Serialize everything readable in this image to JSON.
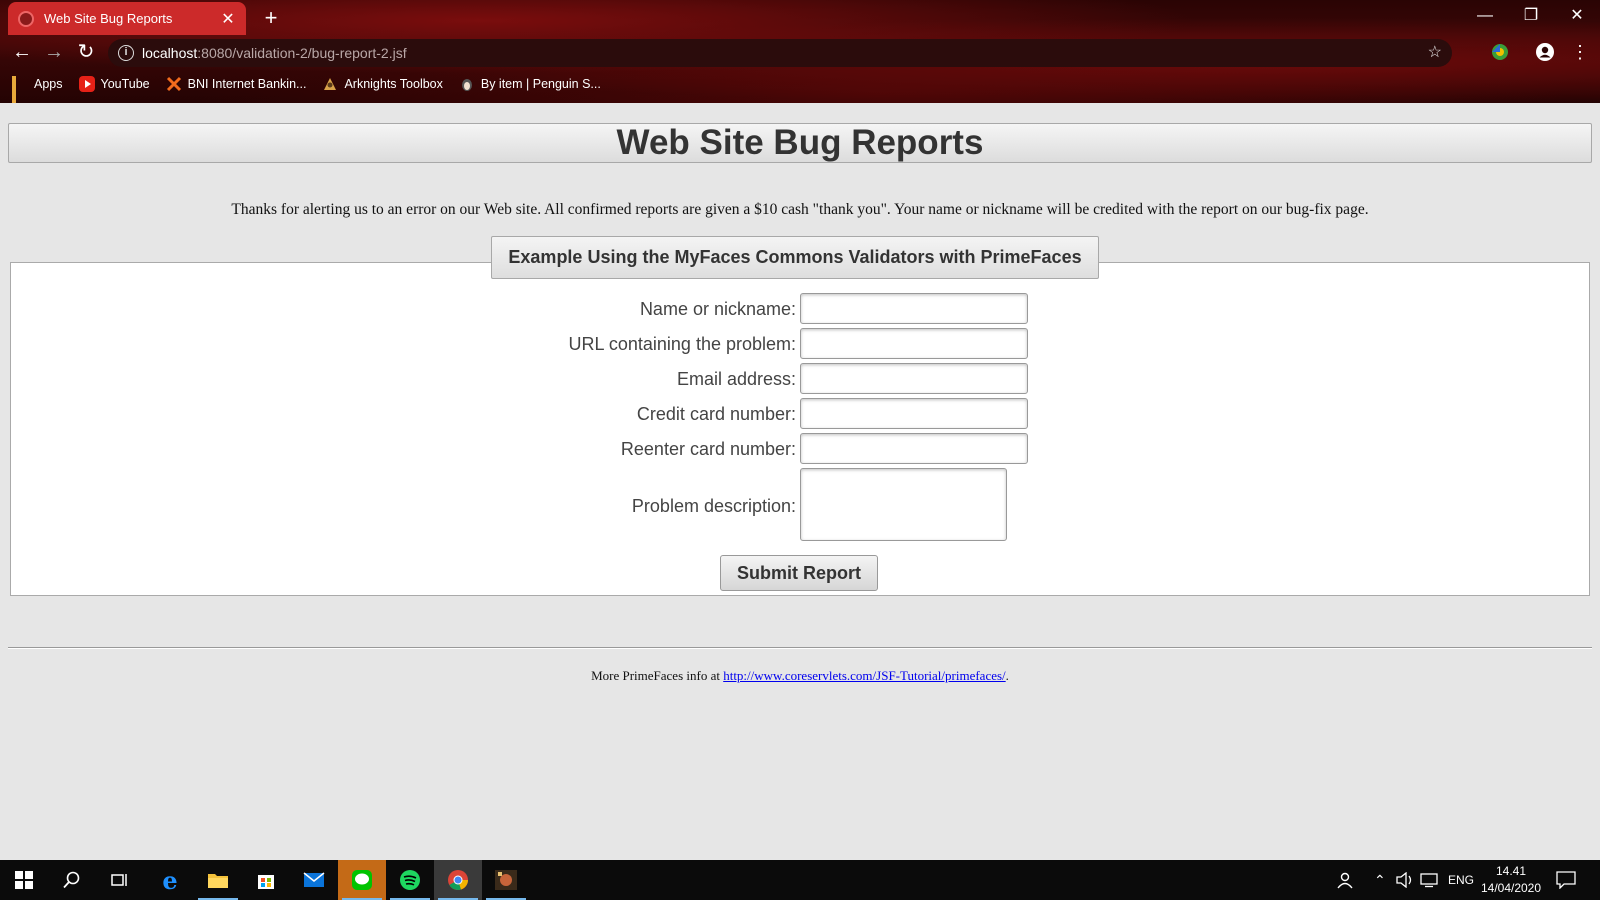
{
  "browser": {
    "tab_title": "Web Site Bug Reports",
    "tab_close": "✕",
    "new_tab": "+",
    "url_host": "localhost",
    "url_path": ":8080/validation-2/bug-report-2.jsf",
    "bookmarks": [
      {
        "label": "Apps",
        "icon": "apps-grid-icon"
      },
      {
        "label": "YouTube",
        "icon": "youtube-icon"
      },
      {
        "label": "BNI Internet Bankin...",
        "icon": "bni-icon"
      },
      {
        "label": "Arknights Toolbox",
        "icon": "arknights-icon"
      },
      {
        "label": "By item | Penguin S...",
        "icon": "penguin-icon"
      }
    ]
  },
  "page": {
    "heading": "Web Site Bug Reports",
    "intro": "Thanks for alerting us to an error on our Web site. All confirmed reports are given a $10 cash \"thank you\". Your name or nickname will be credited with the report on our bug-fix page.",
    "panel_title": "Example Using the MyFaces Commons Validators with PrimeFaces",
    "fields": {
      "name": {
        "label": "Name or nickname:",
        "value": ""
      },
      "url": {
        "label": "URL containing the problem:",
        "value": ""
      },
      "email": {
        "label": "Email address:",
        "value": ""
      },
      "card": {
        "label": "Credit card number:",
        "value": ""
      },
      "card_again": {
        "label": "Reenter card number:",
        "value": ""
      },
      "description": {
        "label": "Problem description:",
        "value": ""
      }
    },
    "submit_label": "Submit Report",
    "footer_prefix": "More PrimeFaces info at ",
    "footer_link": "http://www.coreservlets.com/JSF-Tutorial/primefaces/",
    "footer_suffix": "."
  },
  "taskbar": {
    "language": "ENG",
    "time": "14.41",
    "date": "14/04/2020"
  },
  "colors": {
    "tab_active": "#cc2a2a",
    "page_background": "#e6e6e6",
    "link": "#0000ee"
  }
}
